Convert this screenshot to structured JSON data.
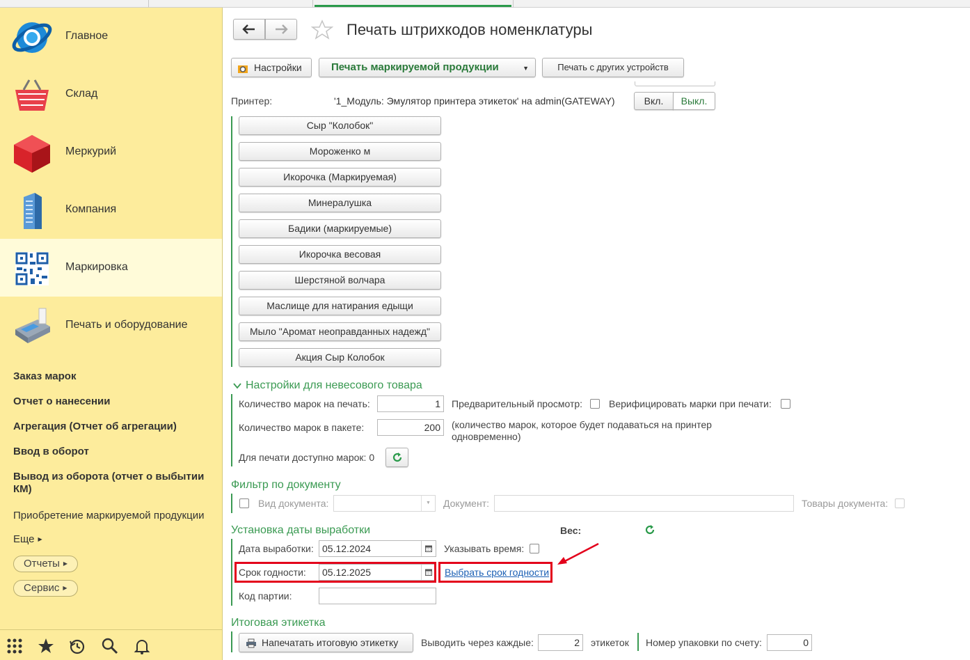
{
  "sidebar": {
    "sections": [
      {
        "label": "Главное"
      },
      {
        "label": "Склад"
      },
      {
        "label": "Меркурий"
      },
      {
        "label": "Компания"
      },
      {
        "label": "Маркировка"
      },
      {
        "label": "Печать и оборудование"
      }
    ],
    "links": [
      "Заказ марок",
      "Отчет о нанесении",
      "Агрегация (Отчет об агрегации)",
      "Ввод в оборот",
      "Вывод из оборота (отчет о выбытии КМ)",
      "Приобретение маркируемой продукции"
    ],
    "more": "Еще",
    "buttons": [
      "Отчеты",
      "Сервис"
    ]
  },
  "header": {
    "title": "Печать штрихкодов номенклатуры",
    "nav_back": "back-arrow-icon",
    "nav_forward": "forward-arrow-icon",
    "favorite": "star-icon"
  },
  "toolbar": {
    "settings": "Настройки",
    "print_marked": "Печать маркируемой продукции",
    "print_other": "Печать с других устройств"
  },
  "printer": {
    "label": "Принтер:",
    "value": "'1_Модуль: Эмулятор принтера этикеток' на admin(GATEWAY)",
    "on": "Вкл.",
    "off": "Выкл."
  },
  "products": [
    "Сыр \"Колобок\"",
    "Мороженко м",
    "Икорочка (Маркируемая)",
    "Минералушка",
    "Бадики (маркируемые)",
    "Икорочка весовая",
    "Шерстяной волчара",
    "Маслище для натирания едыщи",
    "Мыло \"Аромат неоправданных надежд\"",
    "Акция  Сыр Колобок"
  ],
  "nonweight": {
    "header": "Настройки для невесового товара",
    "qty_label": "Количество марок на печать:",
    "qty_value": "1",
    "preview_label": "Предварительный просмотр:",
    "verify_label": "Верифицировать марки при печати:",
    "pack_label": "Количество марок в пакете:",
    "pack_value": "200",
    "pack_note_1": "(количество марок, которое будет подаваться на принтер",
    "pack_note_2": "одновременно)",
    "available_label": "Для печати доступно марок: 0"
  },
  "filter": {
    "header": "Фильтр по документу",
    "doc_type_label": "Вид документа:",
    "doc_label": "Документ:",
    "doc_goods_label": "Товары документа:"
  },
  "production": {
    "header": "Установка даты выработки",
    "weight_label": "Вес:",
    "date_label": "Дата выработки:",
    "date_value": "05.12.2024",
    "time_label": "Указывать время:",
    "expiry_label": "Срок годности:",
    "expiry_value": "05.12.2025",
    "choose_expiry": "Выбрать срок годности",
    "batch_label": "Код партии:",
    "batch_value": ""
  },
  "summary": {
    "header": "Итоговая этикетка",
    "print_button": "Напечатать итоговую этикетку",
    "every_label": "Выводить через каждые:",
    "every_value": "2",
    "labels_word": "этикеток",
    "pack_no_label": "Номер упаковки по счету:",
    "pack_no_value": "0"
  },
  "colors": {
    "accent_green": "#3a9a52",
    "sidebar_bg": "#fdec9c",
    "highlight_red": "#e3001b",
    "link_blue": "#1a5fb4"
  }
}
